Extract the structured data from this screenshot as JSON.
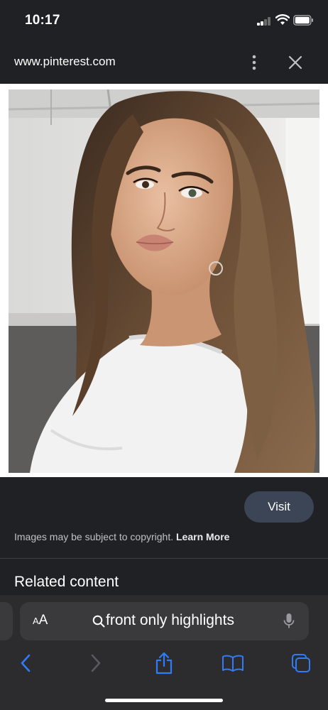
{
  "status_bar": {
    "time": "10:17"
  },
  "url_bar": {
    "url": "www.pinterest.com"
  },
  "photo": {
    "description_icon": "portrait-photo"
  },
  "actions": {
    "visit_label": "Visit",
    "copyright_text": "Images may be subject to copyright.",
    "learn_more_label": "Learn More"
  },
  "related": {
    "heading": "Related content"
  },
  "search_bar": {
    "aa_small": "A",
    "aa_large": "A",
    "query": "front only highlights"
  },
  "colors": {
    "background": "#202124",
    "visit_button": "#3c4556",
    "toolbar_accent": "#2f7cf6",
    "bottom_bar": "#2c2c2e"
  },
  "icons": {
    "more": "more-vertical-icon",
    "close": "close-icon",
    "search": "search-icon",
    "mic": "microphone-icon",
    "back": "chevron-left-icon",
    "forward": "chevron-right-icon",
    "share": "share-icon",
    "bookmarks": "book-icon",
    "tabs": "tabs-icon"
  }
}
